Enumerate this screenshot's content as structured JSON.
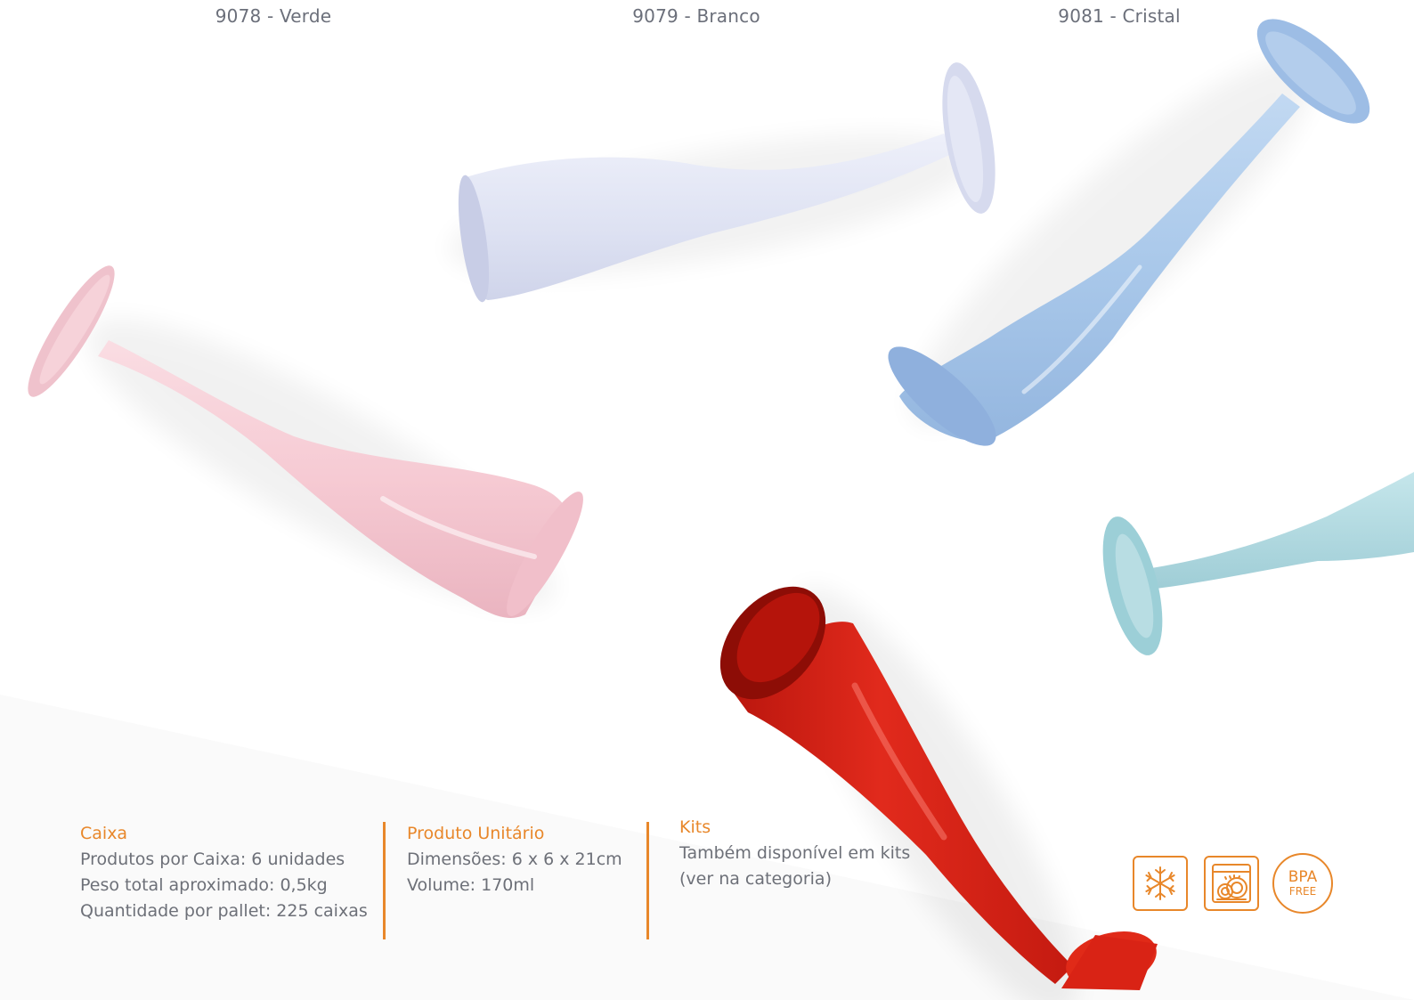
{
  "variants": [
    {
      "label": "9078 - Verde"
    },
    {
      "label": "9079 - Branco"
    },
    {
      "label": "9081 - Cristal"
    }
  ],
  "caixa": {
    "title": "Caixa",
    "lines": [
      "Produtos por Caixa: 6 unidades",
      "Peso total aproximado: 0,5kg",
      "Quantidade por pallet: 225 caixas"
    ]
  },
  "produto": {
    "title": "Produto Unitário",
    "lines": [
      "Dimensões: 6 x 6 x 21cm",
      "Volume: 170ml"
    ]
  },
  "kits": {
    "title": "Kits",
    "lines": [
      "Também disponível em kits",
      "(ver na categoria)"
    ]
  },
  "badges": {
    "freezer_icon": "snowflake-icon",
    "dishwasher_icon": "dishwasher-icon",
    "bpa_main": "BPA",
    "bpa_sub": "FREE"
  },
  "colors": {
    "accent": "#e8872a",
    "glass_pink": "#f4c6cf",
    "glass_white": "#dfe3f3",
    "glass_blue": "#a9c8ea",
    "glass_aqua": "#a9d6de",
    "glass_red": "#cf1f14"
  }
}
